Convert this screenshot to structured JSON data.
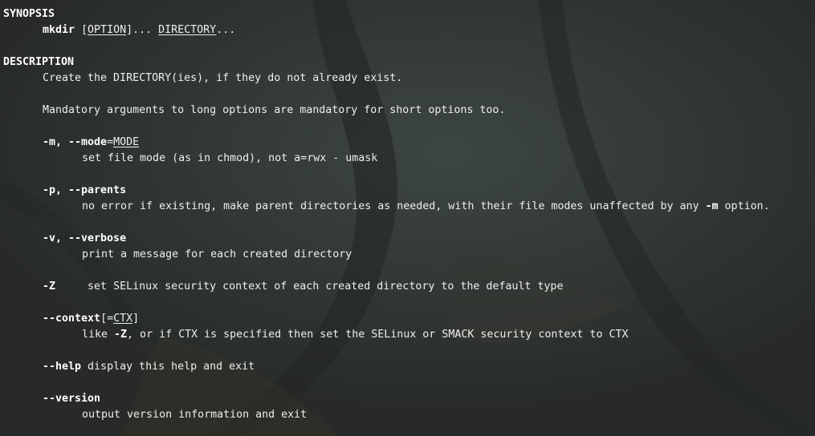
{
  "man_page": {
    "synopsis": {
      "heading": "SYNOPSIS",
      "cmd": "mkdir",
      "sep1": " [",
      "option": "OPTION",
      "sep2": "]... ",
      "directory": "DIRECTORY",
      "tail": "..."
    },
    "description": {
      "heading": "DESCRIPTION",
      "intro": "Create the DIRECTORY(ies), if they do not already exist.",
      "mandatory_note": "Mandatory arguments to long options are mandatory for short options too."
    },
    "options": {
      "mode": {
        "flag": "-m, --mode",
        "eq": "=",
        "arg": "MODE",
        "desc": "set file mode (as in chmod), not a=rwx - umask"
      },
      "parents": {
        "flag": "-p, --parents",
        "desc_pre": "no error if existing, make parent directories as needed, with their file modes unaffected by any ",
        "desc_flag": "-m",
        "desc_post": " option."
      },
      "verbose": {
        "flag": "-v, --verbose",
        "desc": "print a message for each created directory"
      },
      "selinux": {
        "flag": "-Z",
        "gap": "     ",
        "desc": "set SELinux security context of each created directory to the default type"
      },
      "context": {
        "flag": "--context",
        "bracket_open": "[=",
        "arg": "CTX",
        "bracket_close": "]",
        "desc_pre": "like ",
        "desc_flag": "-Z",
        "desc_post": ", or if CTX is specified then set the SELinux or SMACK security context to CTX"
      },
      "help": {
        "flag": "--help",
        "desc": " display this help and exit"
      },
      "version": {
        "flag": "--version",
        "desc": "output version information and exit"
      }
    }
  },
  "colors": {
    "background": "#2c2f2e",
    "text": "#eeeeee",
    "bold_text": "#ffffff"
  }
}
